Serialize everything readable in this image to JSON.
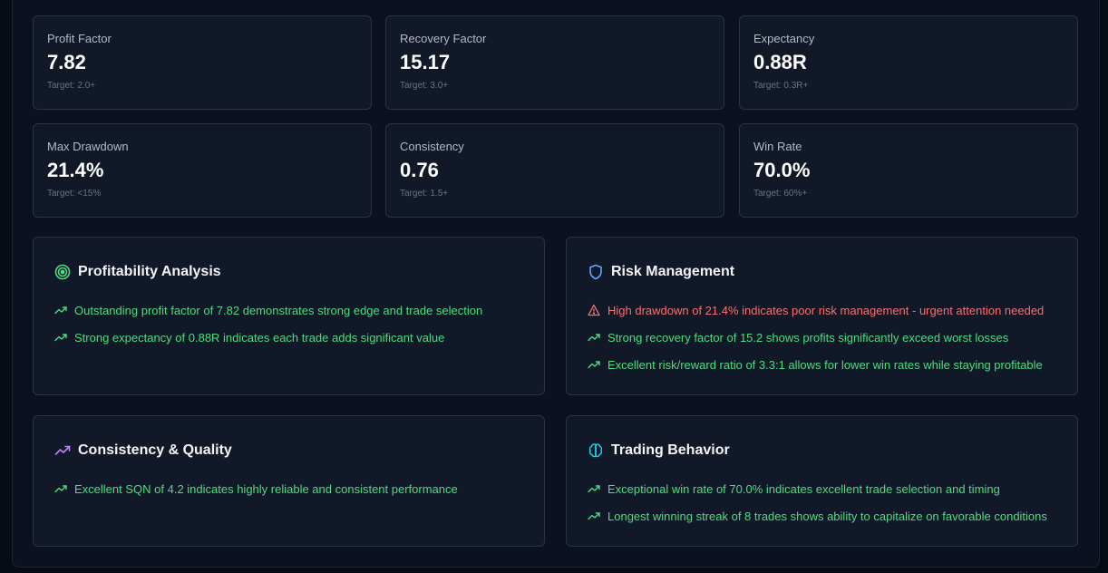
{
  "metrics": [
    {
      "label": "Profit Factor",
      "value": "7.82",
      "target": "Target: 2.0+"
    },
    {
      "label": "Recovery Factor",
      "value": "15.17",
      "target": "Target: 3.0+"
    },
    {
      "label": "Expectancy",
      "value": "0.88R",
      "target": "Target: 0.3R+"
    },
    {
      "label": "Max Drawdown",
      "value": "21.4%",
      "target": "Target: <15%"
    },
    {
      "label": "Consistency",
      "value": "0.76",
      "target": "Target: 1.5+"
    },
    {
      "label": "Win Rate",
      "value": "70.0%",
      "target": "Target: 60%+"
    }
  ],
  "sections": {
    "profitability": {
      "title": "Profitability Analysis",
      "icon": "target-icon",
      "icon_color": "#4ade80",
      "insights": [
        {
          "text": "Outstanding profit factor of 7.82 demonstrates strong edge and trade selection",
          "kind": "positive"
        },
        {
          "text": "Strong expectancy of 0.88R indicates each trade adds significant value",
          "kind": "positive"
        }
      ]
    },
    "risk": {
      "title": "Risk Management",
      "icon": "shield-icon",
      "icon_color": "#60a5fa",
      "insights": [
        {
          "text": "High drawdown of 21.4% indicates poor risk management - urgent attention needed",
          "kind": "warning"
        },
        {
          "text": "Strong recovery factor of 15.2 shows profits significantly exceed worst losses",
          "kind": "positive"
        },
        {
          "text": "Excellent risk/reward ratio of 3.3:1 allows for lower win rates while staying profitable",
          "kind": "positive"
        }
      ]
    },
    "consistency": {
      "title": "Consistency & Quality",
      "icon": "trending-up-icon",
      "icon_color": "#c084fc",
      "insights": [
        {
          "text": "Excellent SQN of 4.2 indicates highly reliable and consistent performance",
          "kind": "positive"
        }
      ]
    },
    "behavior": {
      "title": "Trading Behavior",
      "icon": "brain-icon",
      "icon_color": "#22d3ee",
      "insights": [
        {
          "text": "Exceptional win rate of 70.0% indicates excellent trade selection and timing",
          "kind": "positive"
        },
        {
          "text": "Longest winning streak of 8 trades shows ability to capitalize on favorable conditions",
          "kind": "positive"
        }
      ]
    }
  },
  "colors": {
    "positive": "#4ade80",
    "warning": "#f87171",
    "background": "#070b14",
    "card": "#111827"
  }
}
